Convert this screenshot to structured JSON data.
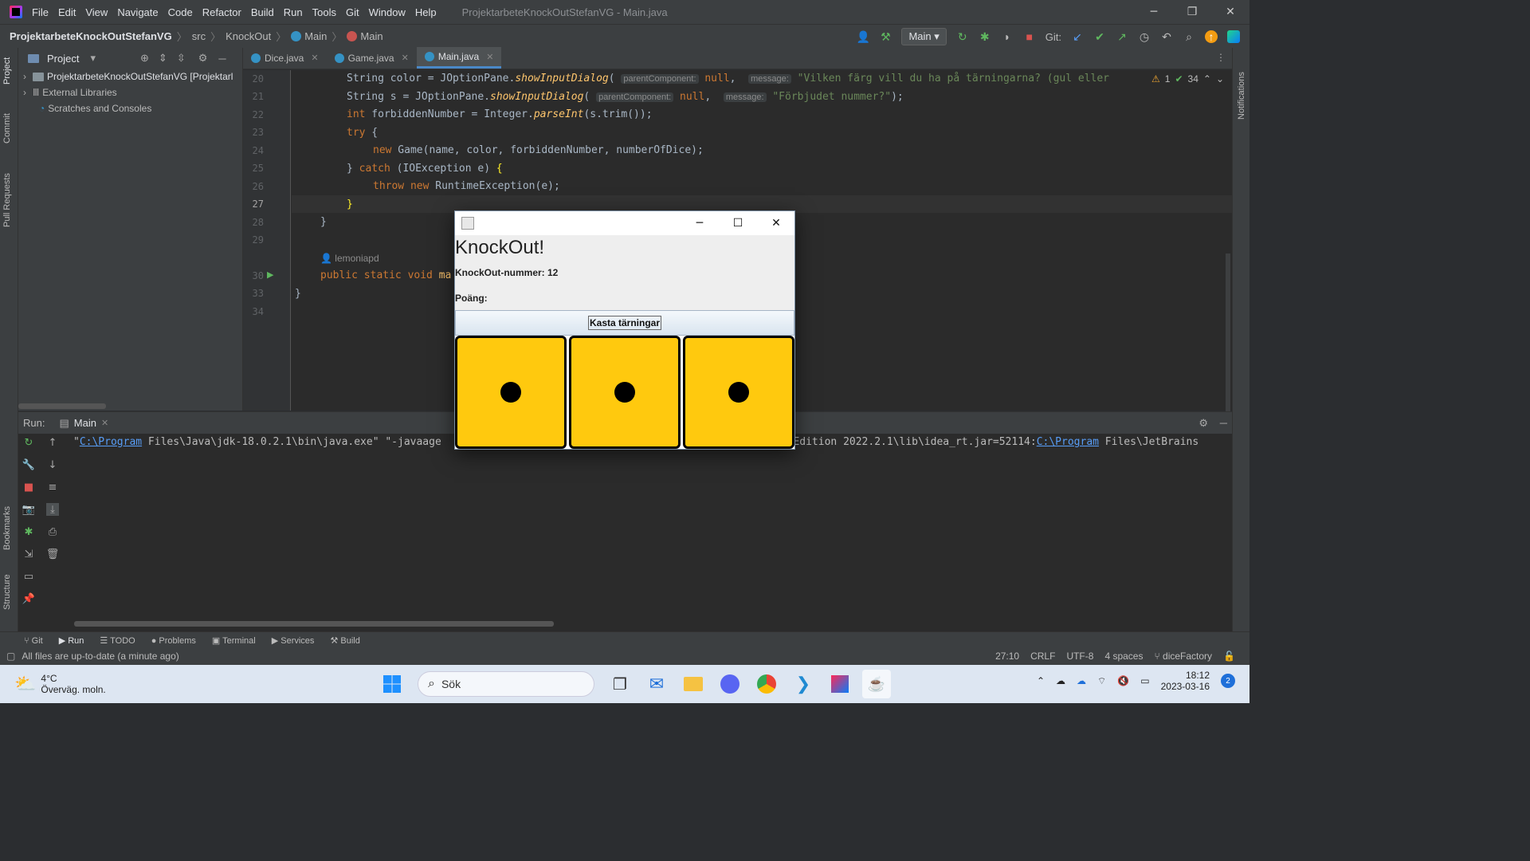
{
  "app": {
    "menu": [
      "File",
      "Edit",
      "View",
      "Navigate",
      "Code",
      "Refactor",
      "Build",
      "Run",
      "Tools",
      "Git",
      "Window",
      "Help"
    ],
    "window_title": "ProjektarbeteKnockOutStefanVG - Main.java"
  },
  "breadcrumb": {
    "project": "ProjektarbeteKnockOutStefanVG",
    "src": "src",
    "package": "KnockOut",
    "class": "Main",
    "method": "Main"
  },
  "toolbar": {
    "run_config": "Main",
    "git_label": "Git:"
  },
  "project_panel": {
    "title": "Project",
    "items": [
      {
        "label": "ProjektarbeteKnockOutStefanVG [Projektarl"
      },
      {
        "label": "External Libraries"
      },
      {
        "label": "Scratches and Consoles"
      }
    ]
  },
  "left_strip": {
    "tabs": [
      "Project",
      "Commit",
      "Pull Requests",
      "Bookmarks",
      "Structure"
    ]
  },
  "right_strip": {
    "tabs": [
      "Notifications"
    ]
  },
  "editor": {
    "tabs": [
      {
        "label": "Dice.java"
      },
      {
        "label": "Game.java"
      },
      {
        "label": "Main.java"
      }
    ],
    "inspection": {
      "warnings": "1",
      "checks": "34"
    },
    "line_numbers": [
      "20",
      "21",
      "22",
      "23",
      "24",
      "25",
      "26",
      "27",
      "28",
      "29",
      "",
      "30",
      "33",
      "34"
    ],
    "author_hint": "lemoniapd",
    "hints": {
      "parentComponent": "parentComponent:",
      "message": "message:"
    }
  },
  "run_panel": {
    "label": "Run:",
    "tab": "Main",
    "output": {
      "a": "\"",
      "b": "C:\\Program",
      "c": " Files\\Java\\jdk-18.0.2.1\\bin\\java.exe\" \"-javaage",
      "d": "y Edition 2022.2.1\\lib\\idea_rt.jar=52114:",
      "e": "C:\\Program",
      "f": " Files\\JetBrains"
    }
  },
  "bottom_tools": [
    "Git",
    "Run",
    "TODO",
    "Problems",
    "Terminal",
    "Services",
    "Build"
  ],
  "status": {
    "message": "All files are up-to-date (a minute ago)",
    "position": "27:10",
    "line_sep": "CRLF",
    "encoding": "UTF-8",
    "indent": "4 spaces",
    "branch": "diceFactory"
  },
  "dialog": {
    "heading": "KnockOut!",
    "knockout_number": "KnockOut-nummer: 12",
    "points": "Poäng:",
    "roll_button": "Kasta tärningar",
    "dice": [
      1,
      1,
      1
    ],
    "die_color": "#ffc90e"
  },
  "taskbar": {
    "temperature": "4°C",
    "weather": "Överväg. moln.",
    "search": "Sök",
    "time": "18:12",
    "date": "2023-03-16",
    "notifications": "2"
  }
}
